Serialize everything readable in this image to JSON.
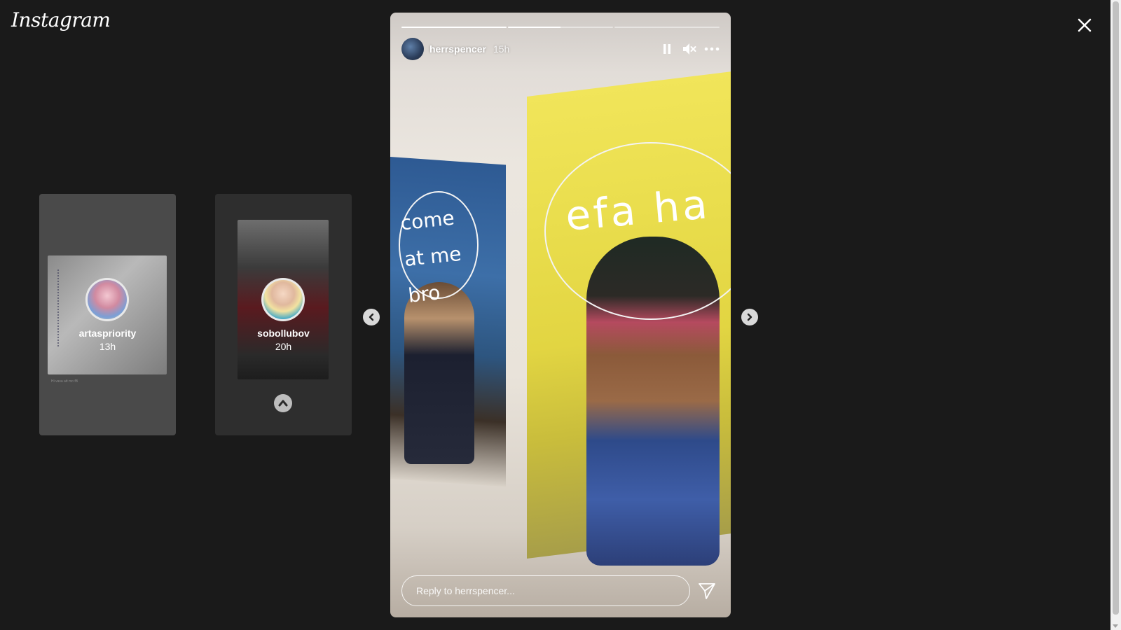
{
  "app": {
    "logo_text": "Instagram"
  },
  "previews": [
    {
      "username": "artaspriority",
      "time": "13h",
      "caption": "Hi vasa att mo fB"
    },
    {
      "username": "sobollubov",
      "time": "20h"
    }
  ],
  "story": {
    "username": "herrspencer",
    "time": "15h",
    "progress": [
      1.0,
      0.5,
      0.0
    ],
    "text_left": "come at me bro",
    "text_right": "efa ha",
    "reply_placeholder": "Reply to herrspencer..."
  },
  "icons": {
    "close": "close-icon",
    "pause": "pause-icon",
    "mute": "muted-speaker-icon",
    "more": "more-options-icon",
    "send": "send-icon",
    "prev": "chevron-left-icon",
    "next": "chevron-right-icon",
    "up": "chevron-up-icon"
  },
  "colors": {
    "background": "#1a1a1a",
    "text": "#ffffff"
  }
}
